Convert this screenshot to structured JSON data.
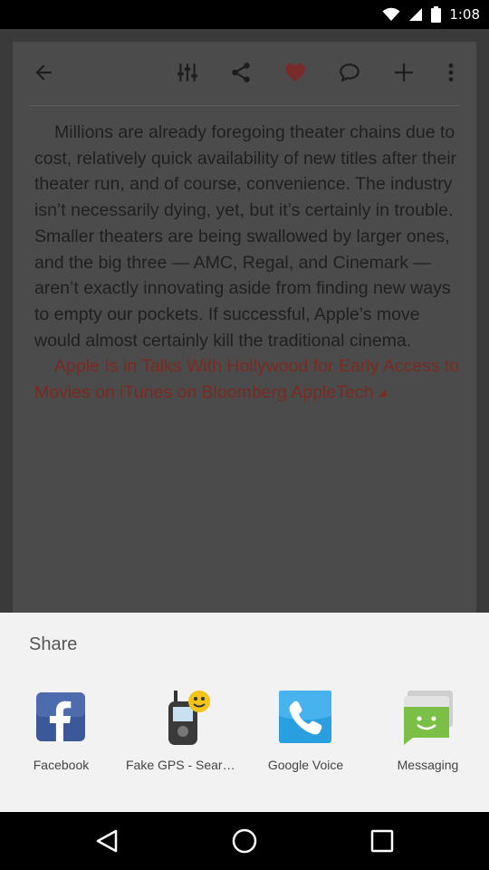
{
  "status_bar": {
    "time": "1:08",
    "icons": [
      "wifi-icon",
      "cell-signal-icon",
      "battery-icon"
    ]
  },
  "toolbar": {
    "icons": [
      "back-arrow-icon",
      "sliders-icon",
      "share-icon",
      "heart-icon",
      "comment-icon",
      "add-icon",
      "more-vert-icon"
    ],
    "heart_color": "#7a2a2a"
  },
  "article": {
    "body": "Millions are already foregoing theater chains due to cost, relatively quick availability of new titles after their theater run, and of course, convenience. The industry isn’t necessarily dying, yet, but it’s certainly in trouble. Smaller theaters are being swallowed by larger ones, and the big three — AMC, Regal, and Cinemark — aren’t exactly innovating aside from finding new ways to empty our pockets. If successful, Apple’s move would almost certainly kill the traditional cinema.",
    "link": "Apple Is in Talks With Hollywood for Early Access to Movies on iTunes on Bloomberg AppleTech",
    "link_color": "#7a2a20"
  },
  "share_sheet": {
    "title": "Share",
    "apps": [
      {
        "label": "Facebook",
        "icon": "facebook-icon"
      },
      {
        "label": "Fake GPS - Search Location",
        "icon": "gps-device-icon"
      },
      {
        "label": "Google Voice",
        "icon": "phone-icon"
      },
      {
        "label": "Messaging",
        "icon": "messaging-icon"
      }
    ]
  },
  "nav_bar": {
    "buttons": [
      "back-icon",
      "home-icon",
      "recents-icon"
    ]
  }
}
